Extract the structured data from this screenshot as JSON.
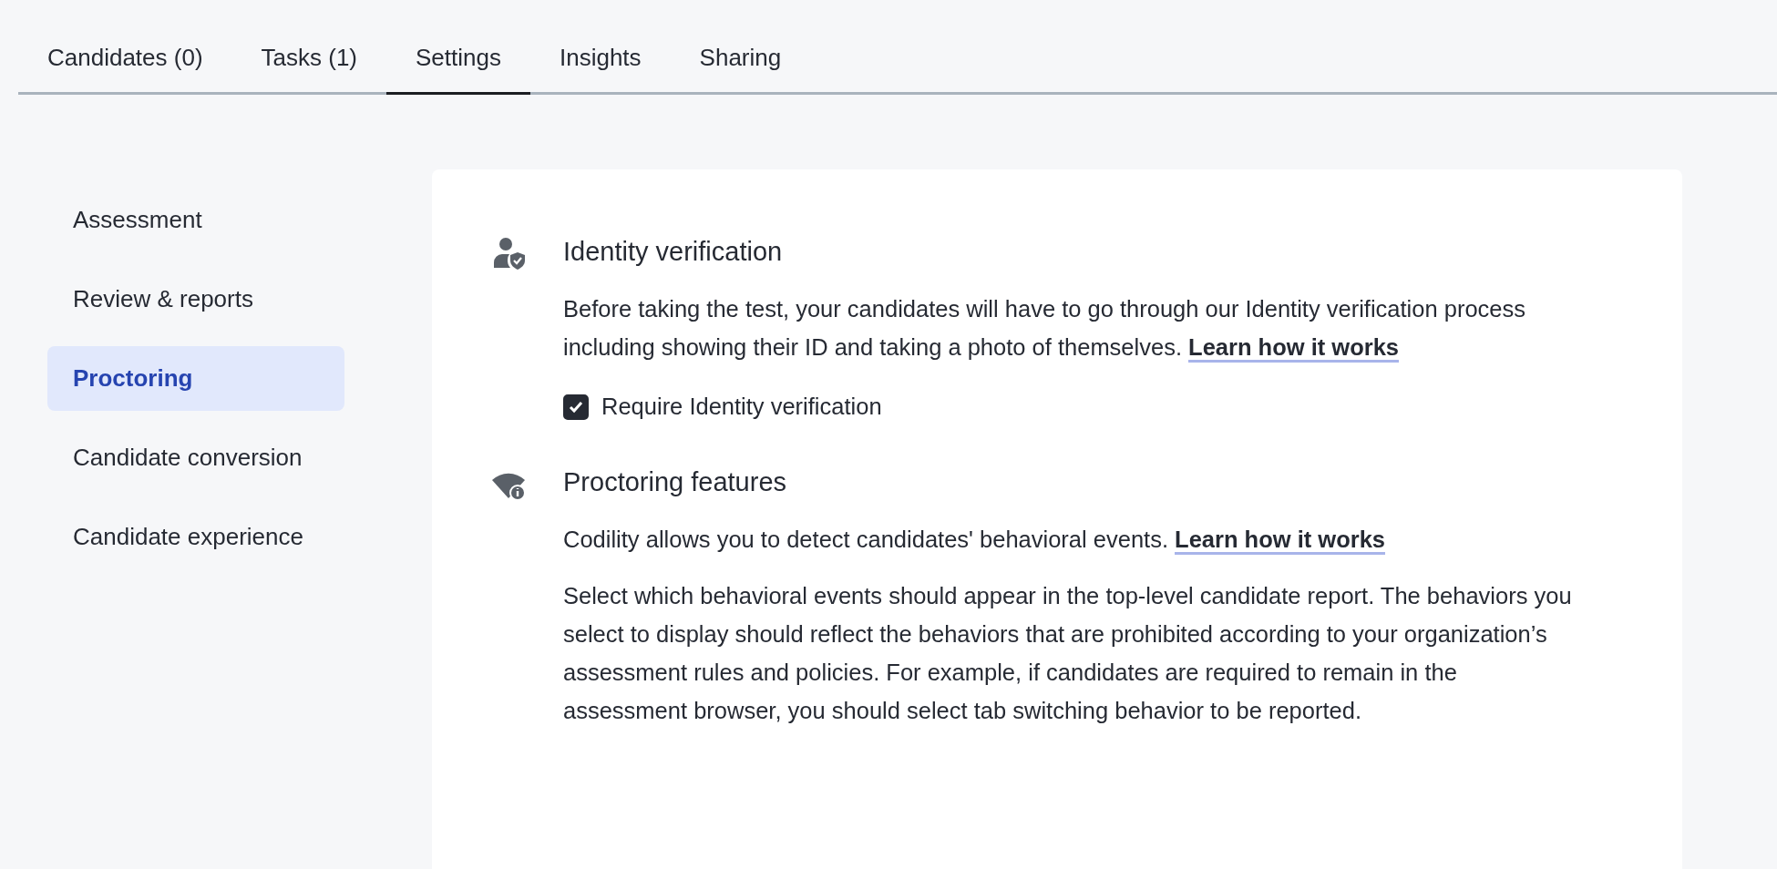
{
  "tabs": [
    {
      "label": "Candidates (0)",
      "selected": false
    },
    {
      "label": "Tasks (1)",
      "selected": false
    },
    {
      "label": "Settings",
      "selected": true
    },
    {
      "label": "Insights",
      "selected": false
    },
    {
      "label": "Sharing",
      "selected": false
    }
  ],
  "sidebar": {
    "items": [
      {
        "label": "Assessment",
        "selected": false
      },
      {
        "label": "Review & reports",
        "selected": false
      },
      {
        "label": "Proctoring",
        "selected": true
      },
      {
        "label": "Candidate conversion",
        "selected": false
      },
      {
        "label": "Candidate experience",
        "selected": false
      }
    ]
  },
  "sections": [
    {
      "kind": "identity",
      "title": "Identity verification",
      "paragraphs": [
        {
          "text": "Before taking the test, your candidates will have to go through our Identity verification process including showing their ID and taking a photo of themselves.",
          "link": "Learn how it works"
        }
      ],
      "checkbox": {
        "label": "Require Identity verification",
        "checked": true
      }
    },
    {
      "kind": "proctoring",
      "title": "Proctoring features",
      "paragraphs": [
        {
          "text": "Codility allows you to detect candidates' behavioral events.",
          "link": "Learn how it works"
        },
        {
          "text": "Select which behavioral events should appear in the top-level candidate report. The behaviors you select to display should reflect the behaviors that are prohibited according to your organization’s assessment rules and policies. For example, if candidates are required to remain in the assessment browser, you should select tab switching behavior to be reported."
        }
      ]
    }
  ]
}
